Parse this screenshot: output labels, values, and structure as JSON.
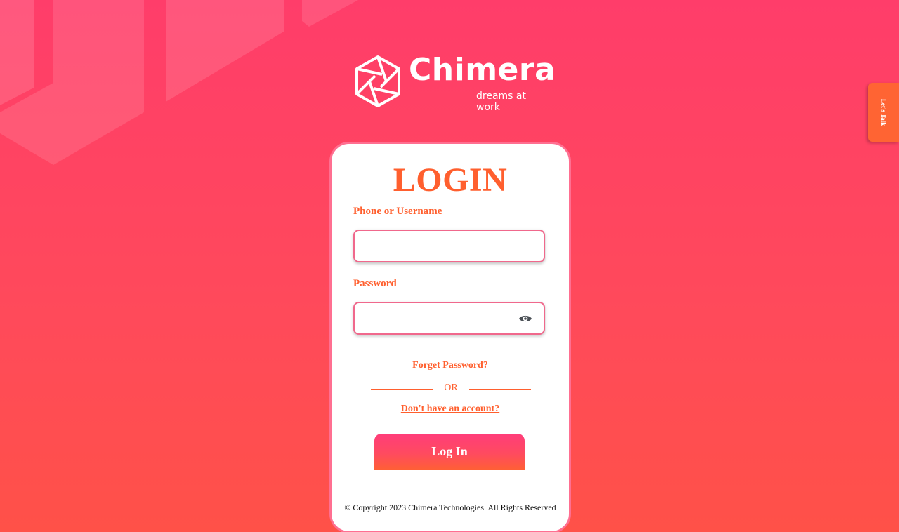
{
  "brand": {
    "name": "Chimera",
    "tagline": "dreams at work"
  },
  "login_card": {
    "title": "LOGIN",
    "username": {
      "label": "Phone or Username",
      "value": "",
      "placeholder": ""
    },
    "password": {
      "label": "Password",
      "value": "",
      "placeholder": "",
      "toggle_icon": "eye-icon"
    },
    "forgot_password": "Forget Password?",
    "divider_text": "OR",
    "signup_link": "Don't have an account?",
    "submit_label": "Log In",
    "copyright": "© Copyright 2023 Chimera Technologies. All Rights Reserved"
  },
  "side_tab": {
    "label": "Let's Talk"
  },
  "colors": {
    "accent": "#ff5f2e",
    "field_border": "#f0688c",
    "card_border": "#ff6f91",
    "background_top": "#ff3d6a",
    "background_bottom": "#ff5148",
    "side_tab": "#ff6433"
  }
}
